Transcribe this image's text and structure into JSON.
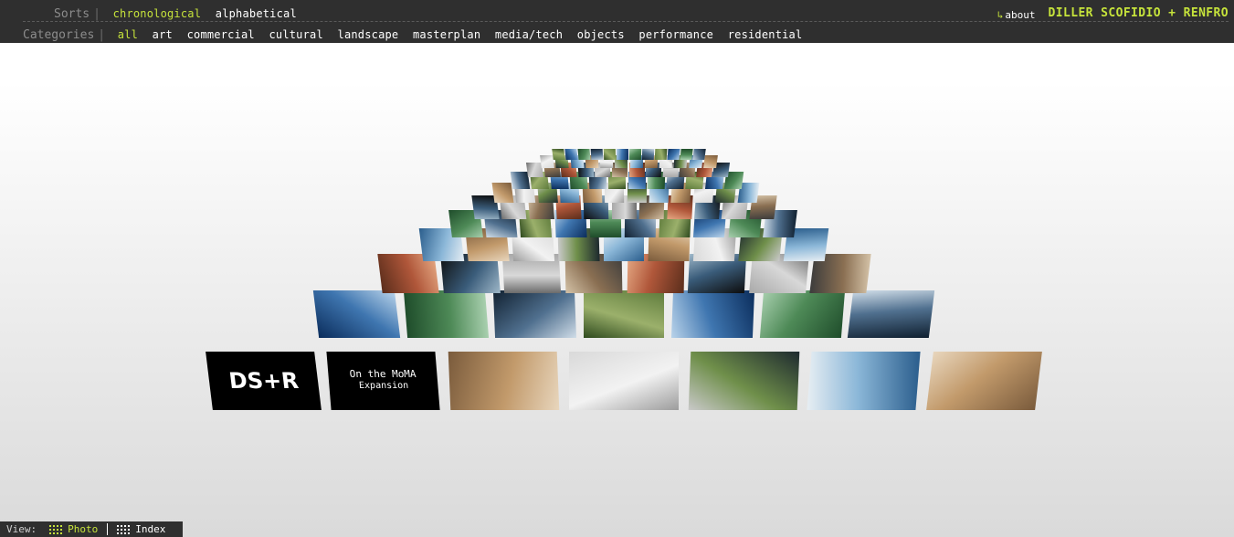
{
  "header": {
    "sorts_label": "Sorts",
    "sorts": [
      {
        "label": "chronological",
        "active": true
      },
      {
        "label": "alphabetical",
        "active": false
      }
    ],
    "categories_label": "Categories",
    "categories": [
      {
        "label": "all",
        "active": true
      },
      {
        "label": "art",
        "active": false
      },
      {
        "label": "commercial",
        "active": false
      },
      {
        "label": "cultural",
        "active": false
      },
      {
        "label": "landscape",
        "active": false
      },
      {
        "label": "masterplan",
        "active": false
      },
      {
        "label": "media/tech",
        "active": false
      },
      {
        "label": "objects",
        "active": false
      },
      {
        "label": "performance",
        "active": false
      },
      {
        "label": "residential",
        "active": false
      }
    ],
    "about_label": "about",
    "brand": "DILLER SCOFIDIO + RENFRO"
  },
  "wall": {
    "front_tiles": [
      {
        "name": "dsr-logo-tile",
        "text": "DS+R"
      },
      {
        "name": "moma-expansion-tile",
        "text_line1": "On the MoMA",
        "text_line2": "Expansion"
      }
    ]
  },
  "colors": {
    "accent": "#c6e33b",
    "bar": "#2f2f2f"
  },
  "viewbar": {
    "view_label": "View:",
    "photo_label": "Photo",
    "index_label": "Index",
    "active": "Photo"
  }
}
